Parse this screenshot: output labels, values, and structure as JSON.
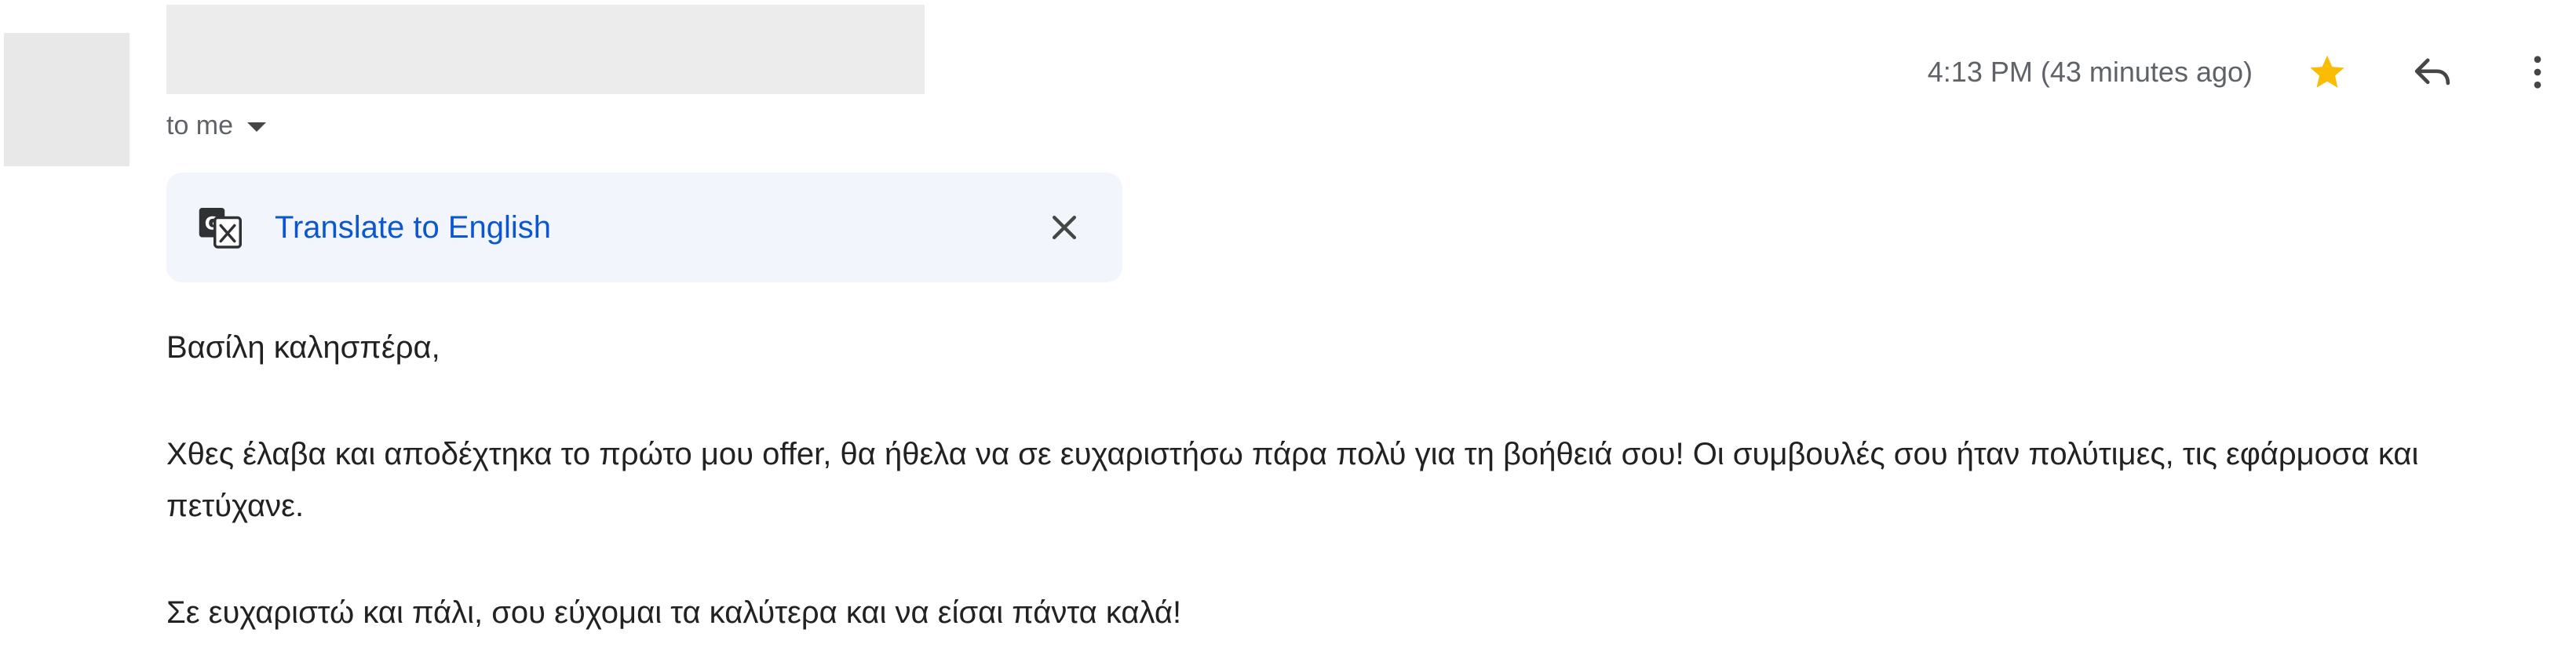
{
  "recipient": {
    "label": "to me"
  },
  "timestamp": "4:13 PM (43 minutes ago)",
  "actions": {
    "star_icon": "star-filled",
    "reply_icon": "reply-arrow",
    "more_icon": "vertical-dots"
  },
  "translate": {
    "icon": "translate",
    "label": "Translate to English",
    "close_icon": "close-x"
  },
  "message": {
    "greeting": "Βασίλη καλησπέρα,",
    "paragraph1": "Χθες έλαβα και αποδέχτηκα το πρώτο μου offer, θα ήθελα να σε ευχαριστήσω πάρα πολύ για τη βοήθειά σου! Οι συμβουλές σου ήταν πολύτιμες, τις εφάρμοσα και πετύχανε.",
    "paragraph2": "Σε ευχαριστώ και πάλι, σου εύχομαι τα καλύτερα και να είσαι πάντα καλά!"
  },
  "colors": {
    "star": "#fbbc04",
    "link": "#0b57d0",
    "translate_bg": "#f2f6fc",
    "placeholder": "#ececec",
    "meta_text": "#5f6368"
  }
}
